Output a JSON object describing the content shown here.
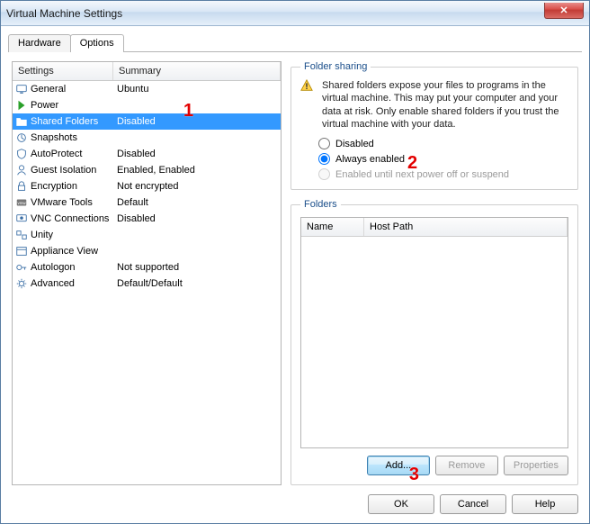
{
  "window": {
    "title": "Virtual Machine Settings",
    "close_x": "✕"
  },
  "tabs": {
    "hardware": "Hardware",
    "options": "Options",
    "active": "Options"
  },
  "list": {
    "header": {
      "settings": "Settings",
      "summary": "Summary"
    },
    "selected_index": 2,
    "items": [
      {
        "icon": "monitor-icon",
        "name": "General",
        "summary": "Ubuntu"
      },
      {
        "icon": "power-icon",
        "name": "Power",
        "summary": ""
      },
      {
        "icon": "folder-icon",
        "name": "Shared Folders",
        "summary": "Disabled"
      },
      {
        "icon": "snapshot-icon",
        "name": "Snapshots",
        "summary": ""
      },
      {
        "icon": "shield-icon",
        "name": "AutoProtect",
        "summary": "Disabled"
      },
      {
        "icon": "user-icon",
        "name": "Guest Isolation",
        "summary": "Enabled, Enabled"
      },
      {
        "icon": "lock-icon",
        "name": "Encryption",
        "summary": "Not encrypted"
      },
      {
        "icon": "vmw-icon",
        "name": "VMware Tools",
        "summary": "Default"
      },
      {
        "icon": "vnc-icon",
        "name": "VNC Connections",
        "summary": "Disabled"
      },
      {
        "icon": "unity-icon",
        "name": "Unity",
        "summary": ""
      },
      {
        "icon": "window-icon",
        "name": "Appliance View",
        "summary": ""
      },
      {
        "icon": "key-icon",
        "name": "Autologon",
        "summary": "Not supported"
      },
      {
        "icon": "gear-icon",
        "name": "Advanced",
        "summary": "Default/Default"
      }
    ]
  },
  "sharing": {
    "legend": "Folder sharing",
    "warning": "Shared folders expose your files to programs in the virtual machine. This may put your computer and your data at risk. Only enable shared folders if you trust the virtual machine with your data.",
    "opt_disabled": "Disabled",
    "opt_always": "Always enabled",
    "opt_until": "Enabled until next power off or suspend",
    "selected": "always"
  },
  "folders": {
    "legend": "Folders",
    "col_name": "Name",
    "col_host": "Host Path",
    "add": "Add...",
    "remove": "Remove",
    "properties": "Properties"
  },
  "buttons": {
    "ok": "OK",
    "cancel": "Cancel",
    "help": "Help"
  },
  "annotations": {
    "a1": "1",
    "a2": "2",
    "a3": "3"
  }
}
